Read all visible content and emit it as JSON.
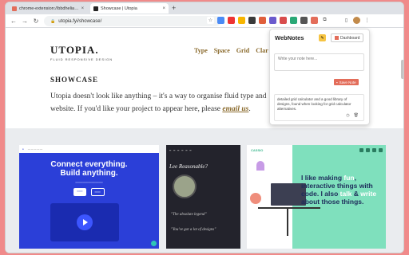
{
  "browser": {
    "tabs": [
      {
        "label": "chrome-extension://bbdhelia…",
        "color": "#e36d5a"
      },
      {
        "label": "chrome-extension://bbdhelia…",
        "color": "#e36d5a"
      },
      {
        "label": "Showcase | Utopia",
        "color": "#222222"
      }
    ],
    "url": "utopia.fyi/showcase/"
  },
  "site": {
    "logo": "UTOPIA.",
    "tagline": "FLUID RESPONSIVE DESIGN",
    "nav": [
      "Type",
      "Space",
      "Grid",
      "Clar"
    ],
    "heading": "SHOWCASE",
    "intro_before": "Utopia doesn't look like anything – it's a way to organise fluid type and",
    "intro_line2": "website. If you'd like your project to appear here, please",
    "intro_link": "email us",
    "intro_after": "."
  },
  "cards": {
    "card1": {
      "title_line1": "Connect everything.",
      "title_line2": "Build anything."
    },
    "card2": {
      "question": "Lee Reasonable?",
      "quote1": "\"The absolute legend\"",
      "quote2": "\"You've got a lot of designs\""
    },
    "card3": {
      "logo": "CASSIO",
      "text_before": "I like making",
      "text_hl1": "fun",
      "text_mid": ", interactive things with code. I also",
      "text_hl2": "talk",
      "text_mid2": "&",
      "text_hl3": "write",
      "text_after": "about those things."
    }
  },
  "popup": {
    "title": "WebNotes",
    "dashboard_label": "Dashboard",
    "input_placeholder": "Write your note here...",
    "save_label": "Save Note",
    "note_text": "detailed grid calculator and a good library of designs, found when looking for grid calculator alternatives.",
    "colors": {
      "accent": "#e36d5a"
    }
  }
}
